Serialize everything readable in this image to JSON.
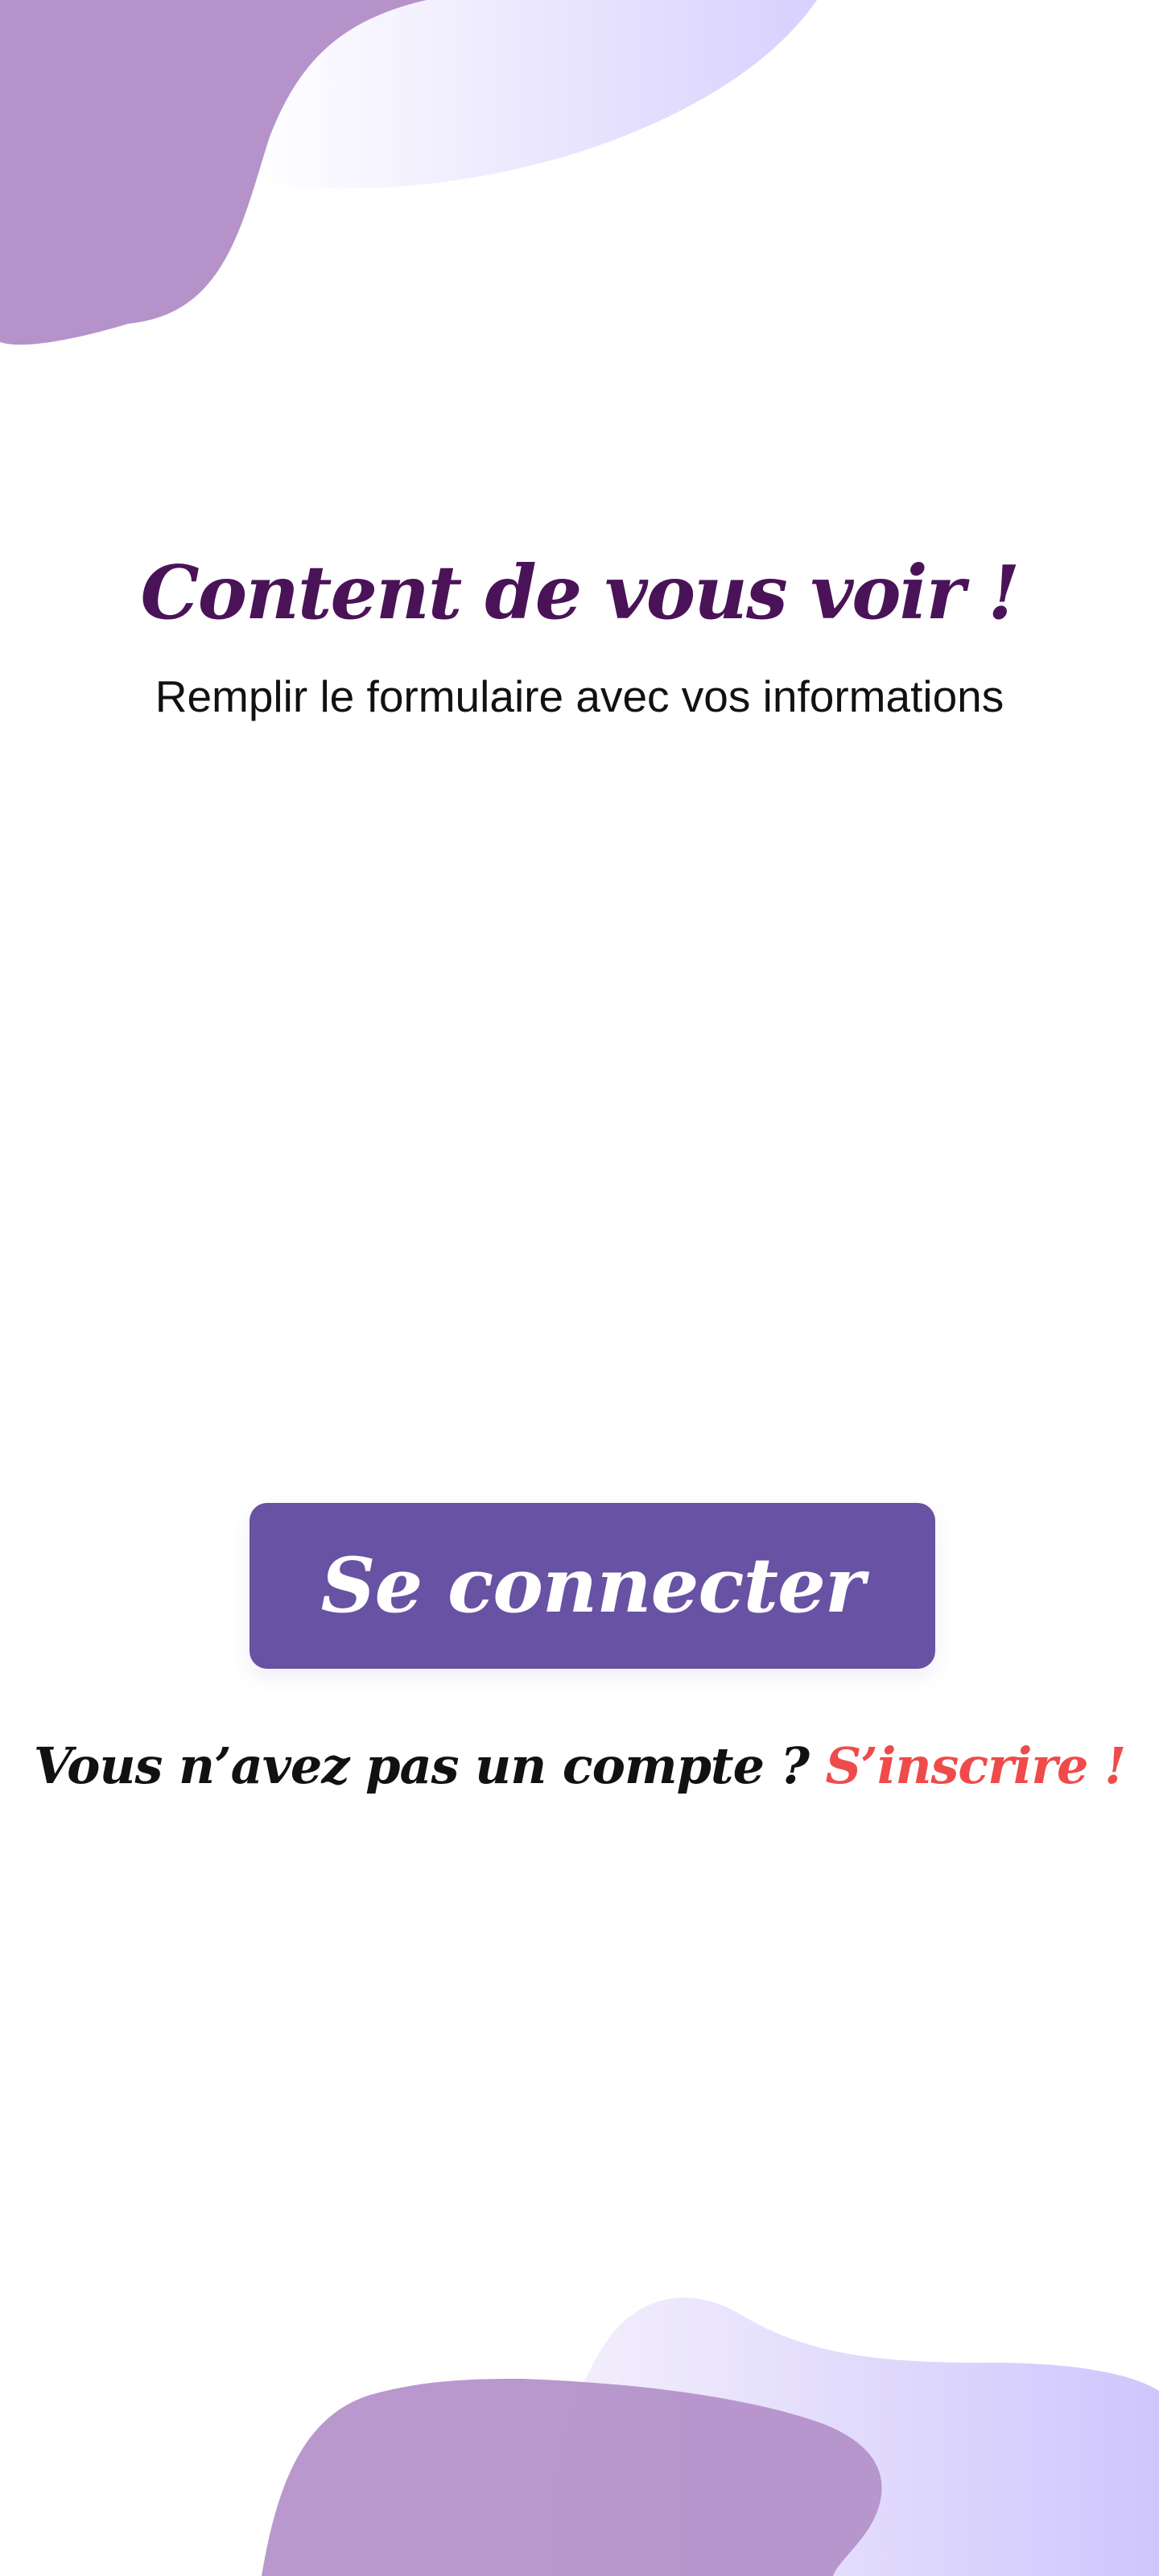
{
  "app": {
    "title": "Content de vous voir !",
    "subtitle": "Remplir le formulaire avec vos informations"
  },
  "actions": {
    "login_label": "Se connecter",
    "signup_prompt": "Vous n’avez pas un compte ?",
    "signup_link": "S’inscrire !"
  },
  "colors": {
    "title": "#4a1358",
    "button": "#6852a3",
    "signup_link": "#ef4b4b",
    "blob_purple": "#b38fc9",
    "blob_lavender": "#d7cffc"
  },
  "decorations": [
    "top-left-blob",
    "bottom-blob"
  ]
}
